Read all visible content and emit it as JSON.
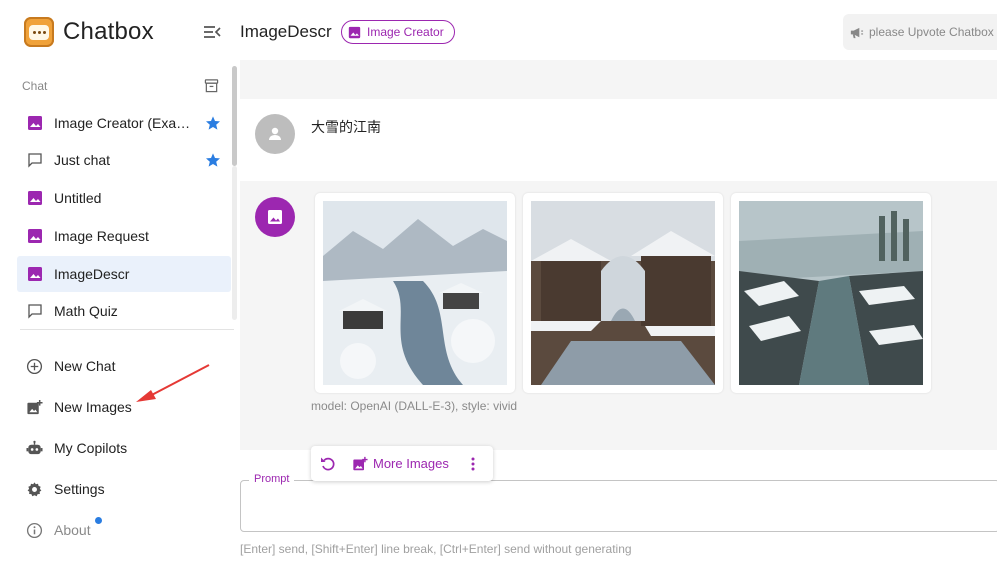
{
  "app": {
    "name": "Chatbox",
    "logo_icon": "chat-bubble-logo-icon"
  },
  "sidebar": {
    "section_label": "Chat",
    "sessions": [
      {
        "label": "Image Creator (Example)",
        "icon": "image-icon",
        "starred": true,
        "active": false
      },
      {
        "label": "Just chat",
        "icon": "chat-icon",
        "starred": true,
        "active": false
      },
      {
        "label": "Untitled",
        "icon": "image-icon",
        "starred": false,
        "active": false
      },
      {
        "label": "Image Request",
        "icon": "image-icon",
        "starred": false,
        "active": false
      },
      {
        "label": "ImageDescr",
        "icon": "image-icon",
        "starred": false,
        "active": true
      },
      {
        "label": "Math Quiz",
        "icon": "chat-icon",
        "starred": false,
        "active": false
      }
    ],
    "nav": [
      {
        "label": "New Chat",
        "icon": "plus-circle-icon"
      },
      {
        "label": "New Images",
        "icon": "add-photo-icon"
      },
      {
        "label": "My Copilots",
        "icon": "robot-icon"
      },
      {
        "label": "Settings",
        "icon": "gear-icon"
      },
      {
        "label": "About",
        "icon": "info-icon",
        "has_notification": true
      }
    ]
  },
  "header": {
    "title": "ImageDescr",
    "chip_label": "Image Creator",
    "upvote_text": "please Upvote Chatbox"
  },
  "messages": {
    "user_text": "大雪的江南",
    "image_note": "model: OpenAI (DALL-E-3), style: vivid",
    "images": [
      "snowy-canal-town-1",
      "snowy-canal-town-2",
      "snowy-canal-town-3"
    ]
  },
  "toolbar": {
    "more_images_label": "More Images"
  },
  "input": {
    "label": "Prompt",
    "value": "",
    "hint": "[Enter] send, [Shift+Enter] line break, [Ctrl+Enter] send without generating"
  },
  "colors": {
    "accent": "#9c27b0",
    "star": "#2a7de1",
    "active_bg": "#eaf1fb",
    "annotation": "#e53935"
  }
}
